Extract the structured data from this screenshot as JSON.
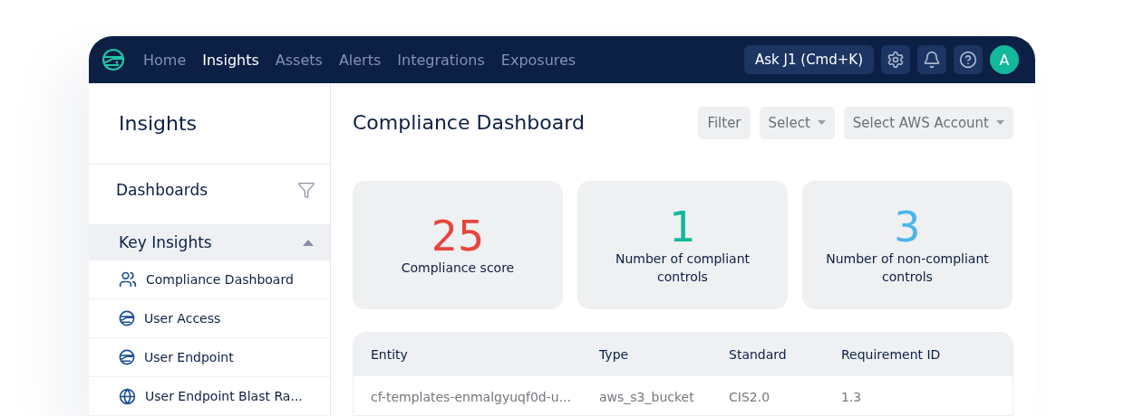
{
  "nav": {
    "tabs": [
      {
        "label": "Home",
        "selected": false
      },
      {
        "label": "Insights",
        "selected": true
      },
      {
        "label": "Assets",
        "selected": false
      },
      {
        "label": "Alerts",
        "selected": false
      },
      {
        "label": "Integrations",
        "selected": false
      },
      {
        "label": "Exposures",
        "selected": false
      }
    ],
    "ask_button": "Ask J1 (Cmd+K)",
    "avatar": "A"
  },
  "sidebar": {
    "title": "Insights",
    "section": "Dashboards",
    "group": {
      "label": "Key Insights",
      "expanded": true,
      "items": [
        {
          "label": "Compliance Dashboard",
          "kind": "users"
        },
        {
          "label": "User Access",
          "kind": "logo"
        },
        {
          "label": "User Endpoint",
          "kind": "logo"
        },
        {
          "label": "User Endpoint Blast Ra...",
          "kind": "globe"
        }
      ]
    }
  },
  "main": {
    "title": "Compliance Dashboard",
    "controls": [
      {
        "label": "Filter",
        "kind": "button"
      },
      {
        "label": "Select",
        "kind": "dropdown"
      },
      {
        "label": "Select AWS Account",
        "kind": "dropdown"
      }
    ],
    "cards": [
      {
        "value": "25",
        "label": "Compliance score",
        "color": "#e8453c"
      },
      {
        "value": "1",
        "label": "Number of compliant controls",
        "color": "#14b89a"
      },
      {
        "value": "3",
        "label": "Number of non-compliant controls",
        "color": "#4ab5ec"
      }
    ],
    "table": {
      "columns": [
        "Entity",
        "Type",
        "Standard",
        "Requirement ID"
      ],
      "rows": [
        [
          "cf-templates-enmalgyuqf0d-u...",
          "aws_s3_bucket",
          "CIS2.0",
          "1.3"
        ]
      ]
    }
  }
}
